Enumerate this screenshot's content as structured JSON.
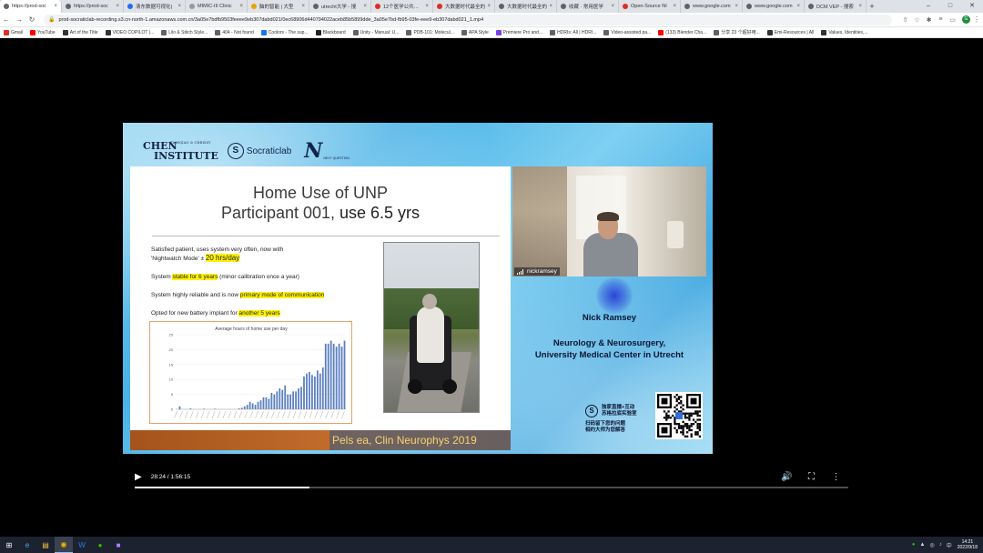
{
  "browser": {
    "tabs": [
      {
        "label": "https://prod-soc",
        "color": "#5f6368",
        "active": true
      },
      {
        "label": "https://prod-soc",
        "color": "#5f6368"
      },
      {
        "label": "清东数据可视化|",
        "color": "#1a73e8"
      },
      {
        "label": "MIMIC-III Clinic",
        "color": "#999"
      },
      {
        "label": "脑的智能 | 大型",
        "color": "#e6a400"
      },
      {
        "label": "utrecht大学 - 搜",
        "color": "#5f6368"
      },
      {
        "label": "12个医学公共数据",
        "color": "#d93025"
      },
      {
        "label": "大数据时代最全的",
        "color": "#d93025"
      },
      {
        "label": "大数据时代最全的",
        "color": "#5f6368"
      },
      {
        "label": "收藏 · 常用医学",
        "color": "#5f6368"
      },
      {
        "label": "Open-Source NI",
        "color": "#d93025"
      },
      {
        "label": "www.google.com",
        "color": "#5f6368"
      },
      {
        "label": "www.google.com",
        "color": "#5f6368"
      },
      {
        "label": "DCM VEP - 搜索",
        "color": "#5f6368"
      }
    ],
    "url": "prod-socraticlab-recording.s3.cn-north-1.amazonaws.com.cn/3a05e7bdfb9503feeee9eb307dabd021/0ec68906d440794022aceb85b5899dde_3a05e7bd-fb95-03fe-eee9-eb307dabd021_1.mp4",
    "profile_initial": "G",
    "bookmarks": [
      {
        "label": "Gmail",
        "color": "#d93025"
      },
      {
        "label": "YouTube",
        "color": "#ff0000"
      },
      {
        "label": "Art of the Title",
        "color": "#333"
      },
      {
        "label": "VIDEO COPILOT |...",
        "color": "#333"
      },
      {
        "label": "Lilo & Stitch Style...",
        "color": "#5f6368"
      },
      {
        "label": "404 - Not found",
        "color": "#5f6368"
      },
      {
        "label": "Coolors - The sup...",
        "color": "#1a73e8"
      },
      {
        "label": "Blackboard",
        "color": "#222"
      },
      {
        "label": "Unity - Manual: U...",
        "color": "#5f6368"
      },
      {
        "label": "PDB-101: Molecul...",
        "color": "#5f6368"
      },
      {
        "label": "APA Style",
        "color": "#5f6368"
      },
      {
        "label": "Premiere Pro and...",
        "color": "#7b3fe4"
      },
      {
        "label": "HDRIs: All | HDRI...",
        "color": "#5f6368"
      },
      {
        "label": "Video-assisted pa...",
        "color": "#5f6368"
      },
      {
        "label": "(133) Blender Cha...",
        "color": "#ff0000"
      },
      {
        "label": "分享 23 个超好用...",
        "color": "#5f6368"
      },
      {
        "label": "Emi-Resources | All",
        "color": "#333"
      },
      {
        "label": "Values, Identities,...",
        "color": "#333"
      }
    ]
  },
  "slide": {
    "logo_chen": "CHEN",
    "logo_institute": "INSTITUTE",
    "logo_tianqiao": "TIANQIAO & CHRISSY",
    "logo_socratic": "Socraticlab",
    "logo_n": "N",
    "logo_nq": "NEXT QUESTION",
    "title_line1": "Home Use of UNP",
    "title_line2a": "Participant 001,  ",
    "title_line2b": "use 6.5 yrs",
    "b1_line1": "Satisfied patient, uses system very often, now with",
    "b1_line2a": "'Nightwatch Mode' ±  ",
    "b1_line2b": "20 hrs/day",
    "b2a": "System ",
    "b2b": "stable for 6 years",
    "b2c": " (minor calibration once a year)",
    "b3a": "System highly reliable and is now ",
    "b3b": "primary mode of communication",
    "b4a": "Opted for new battery implant for ",
    "b4b": "another 5 years",
    "citation": "Pels ea, Clin Neurophys 2019"
  },
  "chart_data": {
    "type": "bar",
    "title": "Average hours of home use per day",
    "ylim": [
      0,
      25
    ],
    "yticks": [
      0,
      5,
      10,
      15,
      20,
      25
    ],
    "values": [
      0,
      1,
      0,
      0,
      0,
      0.3,
      0,
      0,
      0,
      0,
      0.2,
      0,
      0,
      0,
      0.2,
      0,
      0,
      0,
      0,
      0,
      0,
      0,
      0,
      0.3,
      0.5,
      1,
      1.5,
      2.5,
      2,
      1.5,
      2.5,
      3,
      4,
      4,
      3.5,
      5.5,
      5,
      6,
      7,
      6.5,
      8,
      5,
      5,
      6,
      6,
      7,
      7.5,
      11,
      12,
      12.5,
      11.5,
      11,
      13,
      12,
      14,
      22,
      22,
      23,
      22,
      21,
      22,
      21,
      23
    ]
  },
  "webcam": {
    "name": "nickramsey"
  },
  "speaker": {
    "name": "Nick Ramsey",
    "dept_line1": "Neurology & Neurosurgery,",
    "dept_line2": "University Medical Center in Utrecht"
  },
  "promo": {
    "line1": "独家直播+互动",
    "line2": "苏格拉底实验室",
    "line3": "扫码留下您的问题",
    "line4": "相约大师为您解答"
  },
  "player": {
    "time_current": "28:24",
    "time_total": "1:56:15",
    "progress": 0.245
  },
  "taskbar": {
    "time": "14:21",
    "date": "2022/9/18",
    "ime": "中"
  }
}
